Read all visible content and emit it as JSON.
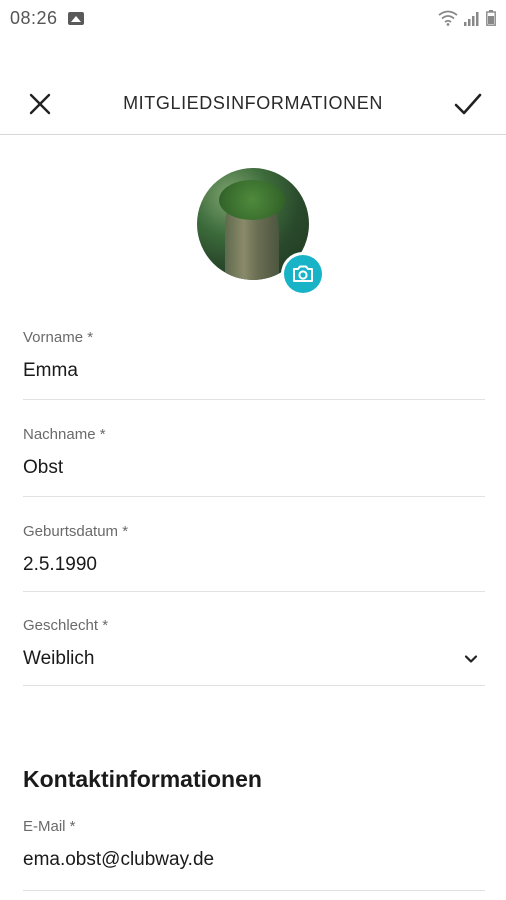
{
  "status_bar": {
    "time": "08:26",
    "icons": [
      "gallery-icon",
      "wifi-icon",
      "signal-icon",
      "battery-icon"
    ]
  },
  "app_bar": {
    "title": "MITGLIEDSINFORMATIONEN",
    "close_icon": "close-icon",
    "confirm_icon": "checkmark-icon"
  },
  "profile": {
    "camera_icon": "camera-icon",
    "accent_color": "#19b3c8"
  },
  "form": {
    "first_name": {
      "label": "Vorname *",
      "value": "Emma"
    },
    "last_name": {
      "label": "Nachname *",
      "value": "Obst"
    },
    "birthdate": {
      "label": "Geburtsdatum *",
      "value": "2.5.1990"
    },
    "gender": {
      "label": "Geschlecht *",
      "value": "Weiblich"
    }
  },
  "contact": {
    "heading": "Kontaktinformationen",
    "email": {
      "label": "E-Mail *",
      "value": "ema.obst@clubway.de"
    }
  }
}
